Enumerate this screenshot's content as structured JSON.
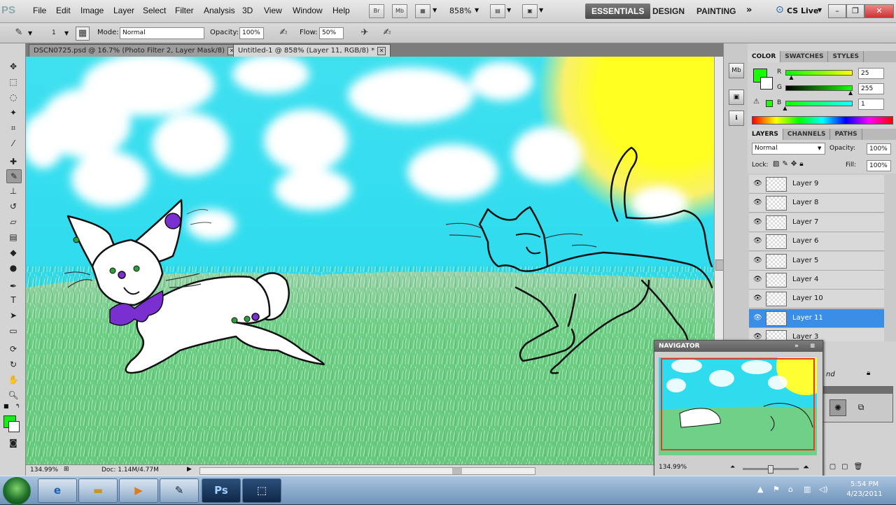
{
  "app": {
    "logo": "PS",
    "menus": [
      "File",
      "Edit",
      "Image",
      "Layer",
      "Select",
      "Filter",
      "Analysis",
      "3D",
      "View",
      "Window",
      "Help"
    ],
    "zoom_select": "858%",
    "workspaces": [
      "ESSENTIALS",
      "DESIGN",
      "PAINTING"
    ],
    "cs_live": "CS Live"
  },
  "options": {
    "brush_size": "1",
    "mode_label": "Mode:",
    "mode_value": "Normal",
    "opacity_label": "Opacity:",
    "opacity_value": "100%",
    "flow_label": "Flow:",
    "flow_value": "50%"
  },
  "tabs": [
    {
      "label": "DSCN0725.psd @ 16.7% (Photo Filter 2, Layer Mask/8)"
    },
    {
      "label": "Untitled-1 @ 858% (Layer 11, RGB/8) *"
    }
  ],
  "status": {
    "zoom": "134.99%",
    "doc": "Doc: 1.14M/4.77M"
  },
  "color_panel": {
    "tabs": [
      "COLOR",
      "SWATCHES",
      "STYLES"
    ],
    "r_label": "R",
    "r_value": "25",
    "g_label": "G",
    "g_value": "255",
    "b_label": "B",
    "b_value": "1",
    "r_level": 0.1,
    "g_level": 1.0,
    "b_level": 0.004,
    "fg_color": "#19ff01"
  },
  "layers_panel": {
    "tabs": [
      "LAYERS",
      "CHANNELS",
      "PATHS"
    ],
    "blend_mode": "Normal",
    "opacity_label": "Opacity:",
    "opacity_value": "100%",
    "lock_label": "Lock:",
    "fill_label": "Fill:",
    "fill_value": "100%",
    "layers": [
      {
        "name": "Layer 9"
      },
      {
        "name": "Layer 8"
      },
      {
        "name": "Layer 7"
      },
      {
        "name": "Layer 6"
      },
      {
        "name": "Layer 5"
      },
      {
        "name": "Layer 4"
      },
      {
        "name": "Layer 10"
      },
      {
        "name": "Layer 11",
        "selected": true
      },
      {
        "name": "Layer 3"
      }
    ],
    "partial_text": "nd"
  },
  "navigator": {
    "title": "NAVIGATOR",
    "zoom": "134.99%"
  },
  "taskbar": {
    "time": "5:54 PM",
    "date": "4/23/2011",
    "ps_label": "Ps"
  }
}
